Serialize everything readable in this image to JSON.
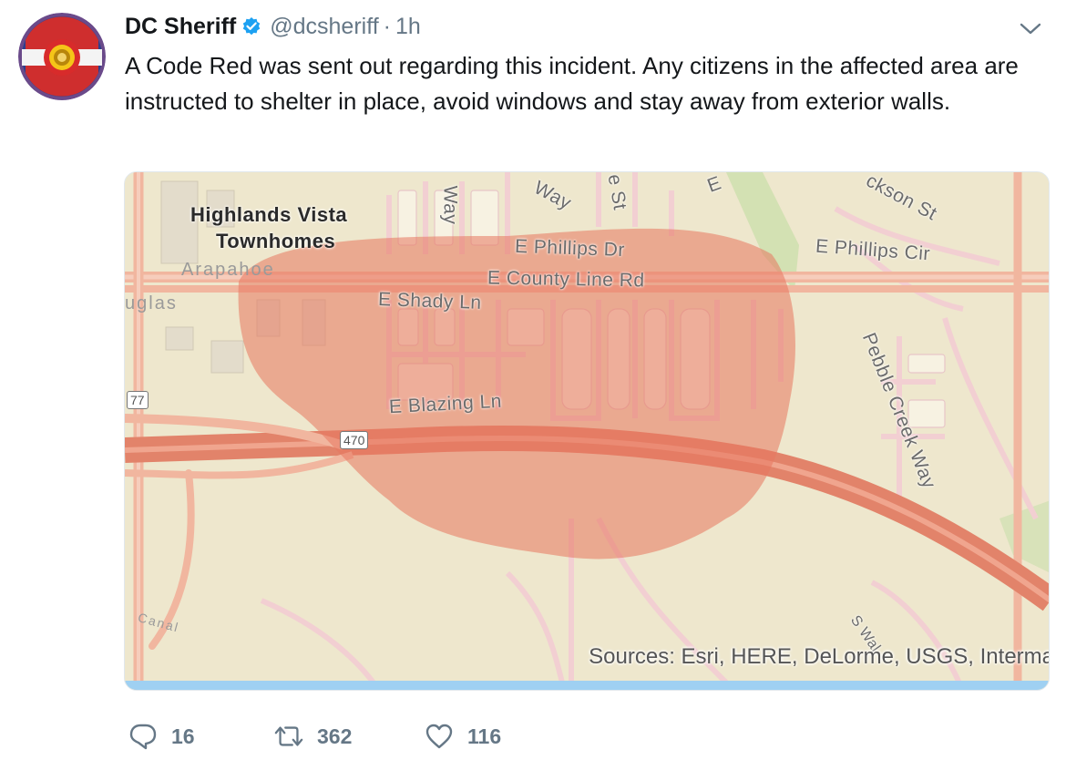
{
  "tweet": {
    "display_name": "DC Sheriff",
    "handle": "@dcsheriff",
    "separator": "·",
    "time": "1h",
    "text": "A Code Red was sent out regarding this incident.  Any citizens in the affected area are instructed to shelter in place, avoid windows and stay away from exterior walls.",
    "colors": {
      "verified": "#1da1f2",
      "secondary_text": "#657786",
      "alert_zone": "#e8765f"
    }
  },
  "map": {
    "labels": {
      "place_line1": "Highlands Vista",
      "place_line2": "Townhomes",
      "arapahoe": "Arapahoe",
      "douglas": "uglas",
      "phillips_dr": "E Phillips Dr",
      "county_line": "E County Line Rd",
      "shady_ln": "E Shady Ln",
      "blazing_ln": "E Blazing Ln",
      "phillips_cir": "E Phillips Cir",
      "jackson_st": "ckson St",
      "pebble_creek": "Pebble Creek Way",
      "way_top": "Way",
      "way_vertical": "Way",
      "st_top": "e St",
      "e_top": "E",
      "route_77": "77",
      "route_470": "470",
      "canal": "Canal",
      "s_wal": "S Wal"
    },
    "attribution": "Sources: Esri, HERE, DeLorme, USGS, Interma"
  },
  "actions": {
    "reply_count": "16",
    "retweet_count": "362",
    "like_count": "116"
  }
}
